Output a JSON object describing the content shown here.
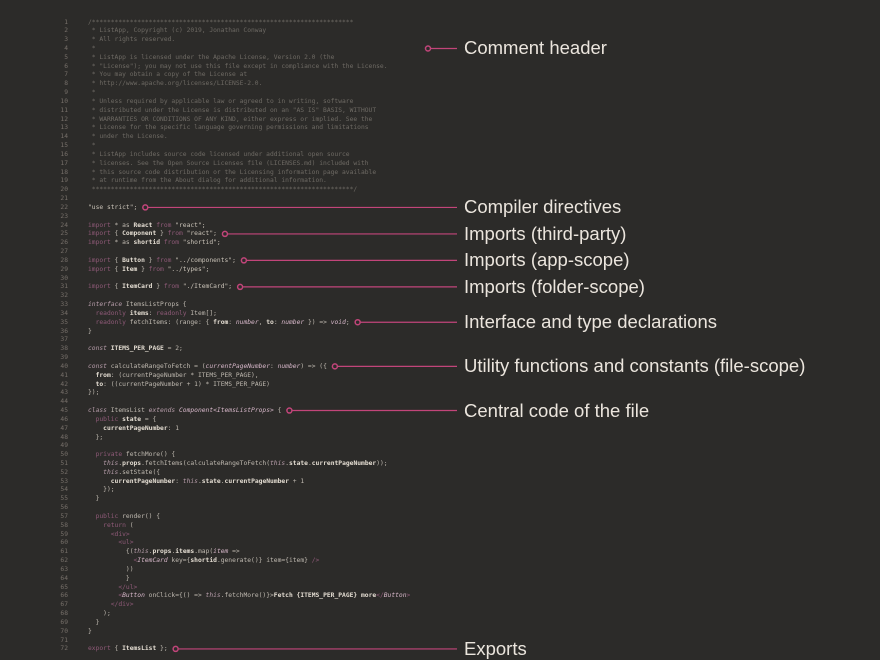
{
  "colors": {
    "background": "#2c2b29",
    "accent": "#c2457a",
    "label_text": "#ebe5dd",
    "code_text": "#bfb9b0",
    "comment_text": "#6e6a64",
    "keyword": "#8f5a78"
  },
  "code_lines": [
    {
      "n": "1",
      "segs": [
        {
          "k": "comment",
          "t": "/*********************************************************************"
        }
      ]
    },
    {
      "n": "2",
      "segs": [
        {
          "k": "comment",
          "t": " * ListApp, Copyright (c) 2019, Jonathan Conway"
        }
      ]
    },
    {
      "n": "3",
      "segs": [
        {
          "k": "comment",
          "t": " * All rights reserved."
        }
      ]
    },
    {
      "n": "4",
      "segs": [
        {
          "k": "comment",
          "t": " *"
        }
      ]
    },
    {
      "n": "5",
      "segs": [
        {
          "k": "comment",
          "t": " * ListApp is licensed under the Apache License, Version 2.0 (the"
        }
      ]
    },
    {
      "n": "6",
      "segs": [
        {
          "k": "comment",
          "t": " * \"License\"); you may not use this file except in compliance with the License."
        }
      ]
    },
    {
      "n": "7",
      "segs": [
        {
          "k": "comment",
          "t": " * You may obtain a copy of the License at"
        }
      ]
    },
    {
      "n": "8",
      "segs": [
        {
          "k": "comment",
          "t": " * http://www.apache.org/licenses/LICENSE-2.0."
        }
      ]
    },
    {
      "n": "9",
      "segs": [
        {
          "k": "comment",
          "t": " *"
        }
      ]
    },
    {
      "n": "10",
      "segs": [
        {
          "k": "comment",
          "t": " * Unless required by applicable law or agreed to in writing, software"
        }
      ]
    },
    {
      "n": "11",
      "segs": [
        {
          "k": "comment",
          "t": " * distributed under the License is distributed on an \"AS IS\" BASIS, WITHOUT"
        }
      ]
    },
    {
      "n": "12",
      "segs": [
        {
          "k": "comment",
          "t": " * WARRANTIES OR CONDITIONS OF ANY KIND, either express or implied. See the"
        }
      ]
    },
    {
      "n": "13",
      "segs": [
        {
          "k": "comment",
          "t": " * License for the specific language governing permissions and limitations"
        }
      ]
    },
    {
      "n": "14",
      "segs": [
        {
          "k": "comment",
          "t": " * under the License."
        }
      ]
    },
    {
      "n": "15",
      "segs": [
        {
          "k": "comment",
          "t": " *"
        }
      ]
    },
    {
      "n": "16",
      "segs": [
        {
          "k": "comment",
          "t": " * ListApp includes source code licensed under additional open source"
        }
      ]
    },
    {
      "n": "17",
      "segs": [
        {
          "k": "comment",
          "t": " * licenses. See the Open Source Licenses file (LICENSES.md) included with"
        }
      ]
    },
    {
      "n": "18",
      "segs": [
        {
          "k": "comment",
          "t": " * this source code distribution or the Licensing information page available"
        }
      ]
    },
    {
      "n": "19",
      "segs": [
        {
          "k": "comment",
          "t": " * at runtime from the About dialog for additional information."
        }
      ]
    },
    {
      "n": "20",
      "segs": [
        {
          "k": "comment",
          "t": " *********************************************************************/"
        }
      ]
    },
    {
      "n": "21",
      "segs": []
    },
    {
      "n": "22",
      "segs": [
        {
          "k": "str",
          "t": "\"use strict\";"
        }
      ]
    },
    {
      "n": "23",
      "segs": []
    },
    {
      "n": "24",
      "segs": [
        {
          "k": "kw",
          "t": "import"
        },
        {
          "k": "plain",
          "t": " * as "
        },
        {
          "k": "id",
          "t": "React"
        },
        {
          "k": "kw",
          "t": " from "
        },
        {
          "k": "str",
          "t": "\"react\";"
        }
      ]
    },
    {
      "n": "25",
      "segs": [
        {
          "k": "kw",
          "t": "import"
        },
        {
          "k": "plain",
          "t": " { "
        },
        {
          "k": "id",
          "t": "Component"
        },
        {
          "k": "plain",
          "t": " }"
        },
        {
          "k": "kw",
          "t": " from "
        },
        {
          "k": "str",
          "t": "\"react\";"
        }
      ]
    },
    {
      "n": "26",
      "segs": [
        {
          "k": "kw",
          "t": "import"
        },
        {
          "k": "plain",
          "t": " * as "
        },
        {
          "k": "id",
          "t": "shortid"
        },
        {
          "k": "kw",
          "t": " from "
        },
        {
          "k": "str",
          "t": "\"shortid\";"
        }
      ]
    },
    {
      "n": "27",
      "segs": []
    },
    {
      "n": "28",
      "segs": [
        {
          "k": "kw",
          "t": "import"
        },
        {
          "k": "plain",
          "t": " { "
        },
        {
          "k": "id",
          "t": "Button"
        },
        {
          "k": "plain",
          "t": " }"
        },
        {
          "k": "kw",
          "t": " from "
        },
        {
          "k": "str",
          "t": "\"../components\";"
        }
      ]
    },
    {
      "n": "29",
      "segs": [
        {
          "k": "kw",
          "t": "import"
        },
        {
          "k": "plain",
          "t": " { "
        },
        {
          "k": "id",
          "t": "Item"
        },
        {
          "k": "plain",
          "t": " }"
        },
        {
          "k": "kw",
          "t": " from "
        },
        {
          "k": "str",
          "t": "\"../types\";"
        }
      ]
    },
    {
      "n": "30",
      "segs": []
    },
    {
      "n": "31",
      "segs": [
        {
          "k": "kw",
          "t": "import"
        },
        {
          "k": "plain",
          "t": " { "
        },
        {
          "k": "id",
          "t": "ItemCard"
        },
        {
          "k": "plain",
          "t": " }"
        },
        {
          "k": "kw",
          "t": " from "
        },
        {
          "k": "str",
          "t": "\"./ItemCard\";"
        }
      ]
    },
    {
      "n": "32",
      "segs": []
    },
    {
      "n": "33",
      "segs": [
        {
          "k": "fn",
          "t": "interface"
        },
        {
          "k": "plain",
          "t": " ItemsListProps {"
        }
      ]
    },
    {
      "n": "34",
      "segs": [
        {
          "k": "kw",
          "t": "  readonly "
        },
        {
          "k": "id",
          "t": "items"
        },
        {
          "k": "plain",
          "t": ": "
        },
        {
          "k": "kw",
          "t": "readonly "
        },
        {
          "k": "plain",
          "t": "Item[];"
        }
      ]
    },
    {
      "n": "35",
      "segs": [
        {
          "k": "kw",
          "t": "  readonly "
        },
        {
          "k": "plain",
          "t": "fetchItems: (range: { "
        },
        {
          "k": "id",
          "t": "from"
        },
        {
          "k": "plain",
          "t": ": "
        },
        {
          "k": "type",
          "t": "number"
        },
        {
          "k": "plain",
          "t": ", "
        },
        {
          "k": "id",
          "t": "to"
        },
        {
          "k": "plain",
          "t": ": "
        },
        {
          "k": "type",
          "t": "number"
        },
        {
          "k": "plain",
          "t": " }) => "
        },
        {
          "k": "type",
          "t": "void"
        },
        {
          "k": "plain",
          "t": ";"
        }
      ]
    },
    {
      "n": "36",
      "segs": [
        {
          "k": "plain",
          "t": "}"
        }
      ]
    },
    {
      "n": "37",
      "segs": []
    },
    {
      "n": "38",
      "segs": [
        {
          "k": "fn",
          "t": "const"
        },
        {
          "k": "plain",
          "t": " "
        },
        {
          "k": "id",
          "t": "ITEMS_PER_PAGE"
        },
        {
          "k": "plain",
          "t": " = 2;"
        }
      ]
    },
    {
      "n": "39",
      "segs": []
    },
    {
      "n": "40",
      "segs": [
        {
          "k": "fn",
          "t": "const"
        },
        {
          "k": "plain",
          "t": " calculateRangeToFetch = ("
        },
        {
          "k": "type",
          "t": "currentPageNumber"
        },
        {
          "k": "plain",
          "t": ": "
        },
        {
          "k": "type",
          "t": "number"
        },
        {
          "k": "plain",
          "t": ") => ({"
        }
      ]
    },
    {
      "n": "41",
      "segs": [
        {
          "k": "id",
          "t": "  from"
        },
        {
          "k": "plain",
          "t": ": (currentPageNumber * ITEMS_PER_PAGE),"
        }
      ]
    },
    {
      "n": "42",
      "segs": [
        {
          "k": "id",
          "t": "  to"
        },
        {
          "k": "plain",
          "t": ": ((currentPageNumber + 1) * ITEMS_PER_PAGE)"
        }
      ]
    },
    {
      "n": "43",
      "segs": [
        {
          "k": "plain",
          "t": "});"
        }
      ]
    },
    {
      "n": "44",
      "segs": []
    },
    {
      "n": "45",
      "segs": [
        {
          "k": "fn",
          "t": "class"
        },
        {
          "k": "plain",
          "t": " ItemsList "
        },
        {
          "k": "fn",
          "t": "extends"
        },
        {
          "k": "plain",
          "t": " "
        },
        {
          "k": "type",
          "t": "Component<ItemsListProps>"
        },
        {
          "k": "plain",
          "t": " {"
        }
      ]
    },
    {
      "n": "46",
      "segs": [
        {
          "k": "kw",
          "t": "  public "
        },
        {
          "k": "id",
          "t": "state"
        },
        {
          "k": "plain",
          "t": " = {"
        }
      ]
    },
    {
      "n": "47",
      "segs": [
        {
          "k": "id",
          "t": "    currentPageNumber"
        },
        {
          "k": "plain",
          "t": ": 1"
        }
      ]
    },
    {
      "n": "48",
      "segs": [
        {
          "k": "plain",
          "t": "  };"
        }
      ]
    },
    {
      "n": "49",
      "segs": []
    },
    {
      "n": "50",
      "segs": [
        {
          "k": "kw",
          "t": "  private "
        },
        {
          "k": "plain",
          "t": "fetchMore() {"
        }
      ]
    },
    {
      "n": "51",
      "segs": [
        {
          "k": "fn",
          "t": "    this"
        },
        {
          "k": "plain",
          "t": "."
        },
        {
          "k": "id",
          "t": "props"
        },
        {
          "k": "plain",
          "t": ".fetchItems(calculateRangeToFetch("
        },
        {
          "k": "fn",
          "t": "this"
        },
        {
          "k": "plain",
          "t": "."
        },
        {
          "k": "id",
          "t": "state"
        },
        {
          "k": "plain",
          "t": "."
        },
        {
          "k": "id",
          "t": "currentPageNumber"
        },
        {
          "k": "plain",
          "t": "));"
        }
      ]
    },
    {
      "n": "52",
      "segs": [
        {
          "k": "fn",
          "t": "    this"
        },
        {
          "k": "plain",
          "t": ".setState({"
        }
      ]
    },
    {
      "n": "53",
      "segs": [
        {
          "k": "id",
          "t": "      currentPageNumber"
        },
        {
          "k": "plain",
          "t": ": "
        },
        {
          "k": "fn",
          "t": "this"
        },
        {
          "k": "plain",
          "t": "."
        },
        {
          "k": "id",
          "t": "state"
        },
        {
          "k": "plain",
          "t": "."
        },
        {
          "k": "id",
          "t": "currentPageNumber"
        },
        {
          "k": "plain",
          "t": " + 1"
        }
      ]
    },
    {
      "n": "54",
      "segs": [
        {
          "k": "plain",
          "t": "    });"
        }
      ]
    },
    {
      "n": "55",
      "segs": [
        {
          "k": "plain",
          "t": "  }"
        }
      ]
    },
    {
      "n": "56",
      "segs": []
    },
    {
      "n": "57",
      "segs": [
        {
          "k": "kw",
          "t": "  public "
        },
        {
          "k": "plain",
          "t": "render() {"
        }
      ]
    },
    {
      "n": "58",
      "segs": [
        {
          "k": "kw",
          "t": "    return "
        },
        {
          "k": "plain",
          "t": "("
        }
      ]
    },
    {
      "n": "59",
      "segs": [
        {
          "k": "kw",
          "t": "      <div>"
        }
      ]
    },
    {
      "n": "60",
      "segs": [
        {
          "k": "kw",
          "t": "        <ul>"
        }
      ]
    },
    {
      "n": "61",
      "segs": [
        {
          "k": "plain",
          "t": "          {("
        },
        {
          "k": "fn",
          "t": "this"
        },
        {
          "k": "plain",
          "t": "."
        },
        {
          "k": "id",
          "t": "props"
        },
        {
          "k": "plain",
          "t": "."
        },
        {
          "k": "id",
          "t": "items"
        },
        {
          "k": "plain",
          "t": ".map("
        },
        {
          "k": "type",
          "t": "item"
        },
        {
          "k": "plain",
          "t": " =>"
        }
      ]
    },
    {
      "n": "62",
      "segs": [
        {
          "k": "kw",
          "t": "            <"
        },
        {
          "k": "type",
          "t": "ItemCard"
        },
        {
          "k": "plain",
          "t": " key={"
        },
        {
          "k": "id",
          "t": "shortid"
        },
        {
          "k": "plain",
          "t": ".generate()} item={item} "
        },
        {
          "k": "kw",
          "t": "/>"
        }
      ]
    },
    {
      "n": "63",
      "segs": [
        {
          "k": "plain",
          "t": "          ))"
        }
      ]
    },
    {
      "n": "64",
      "segs": [
        {
          "k": "plain",
          "t": "          }"
        }
      ]
    },
    {
      "n": "65",
      "segs": [
        {
          "k": "kw",
          "t": "        </ul>"
        }
      ]
    },
    {
      "n": "66",
      "segs": [
        {
          "k": "kw",
          "t": "        <"
        },
        {
          "k": "type",
          "t": "Button"
        },
        {
          "k": "plain",
          "t": " onClick={() => "
        },
        {
          "k": "fn",
          "t": "this"
        },
        {
          "k": "plain",
          "t": ".fetchMore()}>"
        },
        {
          "k": "id",
          "t": "Fetch {ITEMS_PER_PAGE} more"
        },
        {
          "k": "kw",
          "t": "</"
        },
        {
          "k": "type",
          "t": "Button"
        },
        {
          "k": "kw",
          "t": ">"
        }
      ]
    },
    {
      "n": "67",
      "segs": [
        {
          "k": "kw",
          "t": "      </div>"
        }
      ]
    },
    {
      "n": "68",
      "segs": [
        {
          "k": "plain",
          "t": "    );"
        }
      ]
    },
    {
      "n": "69",
      "segs": [
        {
          "k": "plain",
          "t": "  }"
        }
      ]
    },
    {
      "n": "70",
      "segs": [
        {
          "k": "plain",
          "t": "}"
        }
      ]
    },
    {
      "n": "71",
      "segs": []
    },
    {
      "n": "72",
      "segs": [
        {
          "k": "kw",
          "t": "export"
        },
        {
          "k": "plain",
          "t": " { "
        },
        {
          "k": "id",
          "t": "ItemsList"
        },
        {
          "k": "plain",
          "t": " };"
        }
      ]
    }
  ],
  "annotations": [
    {
      "label": "Comment header",
      "line": 4
    },
    {
      "label": "Compiler directives",
      "line": 22
    },
    {
      "label": "Imports (third-party)",
      "line": 25
    },
    {
      "label": "Imports (app-scope)",
      "line": 28
    },
    {
      "label": "Imports (folder-scope)",
      "line": 31
    },
    {
      "label": "Interface and type declarations",
      "line": 35
    },
    {
      "label": "Utility functions and constants (file-scope)",
      "line": 40
    },
    {
      "label": "Central code of the file",
      "line": 45
    },
    {
      "label": "Exports",
      "line": 72
    }
  ]
}
